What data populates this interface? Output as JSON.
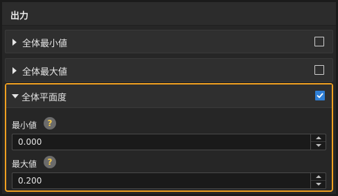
{
  "panel": {
    "title": "出力"
  },
  "rows": [
    {
      "label": "全体最小値",
      "checked": false
    },
    {
      "label": "全体最大値",
      "checked": false
    }
  ],
  "expanded": {
    "label": "全体平面度",
    "checked": true,
    "fields": [
      {
        "label": "最小値",
        "help": "?",
        "value": "0.000"
      },
      {
        "label": "最大値",
        "help": "?",
        "value": "0.200"
      }
    ]
  },
  "colors": {
    "accent_border": "#f0a020",
    "checkbox_checked": "#2f7fd6",
    "help_mark": "#f2c94c"
  },
  "icons": [
    "expand-right-icon",
    "collapse-down-icon",
    "help-icon",
    "spin-up-icon",
    "spin-down-icon",
    "checkmark-icon"
  ]
}
